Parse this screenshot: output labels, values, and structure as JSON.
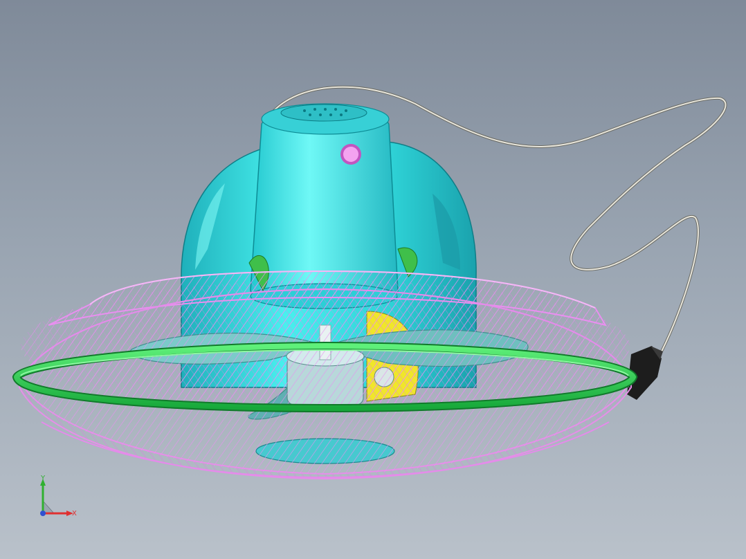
{
  "viewport": {
    "model": "desk-fan-assembly",
    "colors": {
      "background_top": "#7f8a99",
      "background_bottom": "#b9c1ca",
      "motor_housing": "#3fe0e0",
      "motor_housing_dark": "#23b6bf",
      "guard_wire": "#e58fe8",
      "guard_ring": "#2bd94b",
      "blade": "#6fbfbf",
      "hub": "#b8d8da",
      "cord": "#d9d9d0",
      "plug": "#1d1d1d",
      "button": "#e77ee0",
      "yellow_part": "#f0e62a",
      "green_part": "#3fbf4a"
    }
  },
  "triad": {
    "x_label": "X",
    "y_label": "Y",
    "x_color": "#e03030",
    "y_color": "#30b030",
    "z_color": "#3050d0"
  }
}
